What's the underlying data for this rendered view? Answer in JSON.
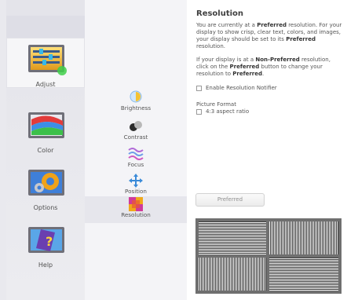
{
  "nav": {
    "items": [
      {
        "label": "Adjust",
        "icon": "adjust-icon",
        "active": true
      },
      {
        "label": "Color",
        "icon": "color-icon",
        "active": false
      },
      {
        "label": "Options",
        "icon": "options-icon",
        "active": false
      },
      {
        "label": "Help",
        "icon": "help-icon",
        "active": false
      }
    ]
  },
  "submenu": {
    "items": [
      {
        "label": "Brightness",
        "icon": "brightness-icon"
      },
      {
        "label": "Contrast",
        "icon": "contrast-icon"
      },
      {
        "label": "Focus",
        "icon": "focus-icon"
      },
      {
        "label": "Position",
        "icon": "position-icon"
      },
      {
        "label": "Resolution",
        "icon": "resolution-icon",
        "active": true
      }
    ]
  },
  "content": {
    "title": "Resolution",
    "para1": {
      "t1": "You are currently at a ",
      "b1": "Preferred",
      "t2": " resolution. For your display to show crisp, clear text, colors, and images, your display should be set to its ",
      "b2": "Preferred",
      "t3": " resolution."
    },
    "para2": {
      "t1": "If your display is at a ",
      "b1": "Non-Preferred",
      "t2": " resolution, click on the ",
      "b2": "Preferred",
      "t3": " button to change your resolution to ",
      "b3": "Preferred",
      "t4": "."
    },
    "notifier_label": "Enable Resolution Notifier",
    "notifier_checked": false,
    "picture_format_label": "Picture Format",
    "aspect_label": "4:3 aspect ratio",
    "aspect_checked": false,
    "preferred_button": "Preferred"
  },
  "colors": {
    "active_nav_bg": "#f6f6f8",
    "content_bg": "#ffffff",
    "pattern_bg": "#6f6f6f"
  }
}
